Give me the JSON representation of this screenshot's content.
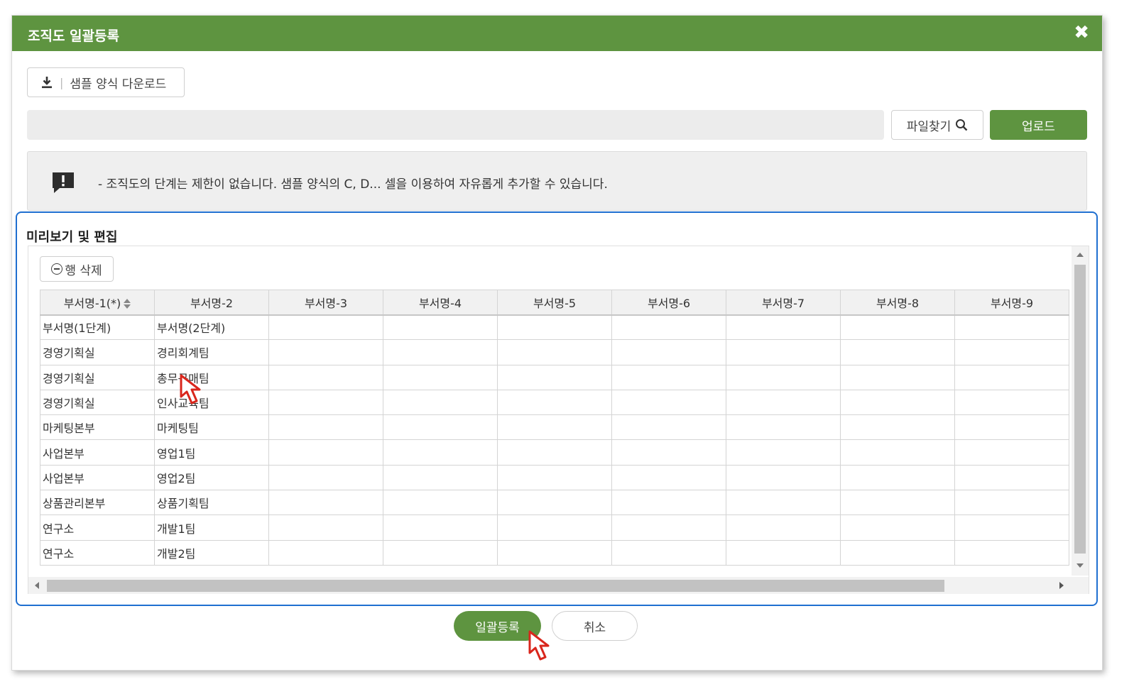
{
  "dialog": {
    "title": "조직도 일괄등록",
    "close_symbol": "✖"
  },
  "toolbar": {
    "download_label": "샘플 양식 다운로드",
    "download_separator": "|",
    "find_file_label": "파일찾기",
    "upload_label": "업로드"
  },
  "notice": {
    "text": "- 조직도의 단계는 제한이 없습니다. 샘플 양식의 C, D... 셀을 이용하여 자유롭게 추가할 수 있습니다."
  },
  "preview": {
    "title": "미리보기 및 편집",
    "delete_row_label": "행 삭제",
    "columns": [
      "부서명-1(*)",
      "부서명-2",
      "부서명-3",
      "부서명-4",
      "부서명-5",
      "부서명-6",
      "부서명-7",
      "부서명-8",
      "부서명-9"
    ],
    "rows": [
      [
        "부서명(1단계)",
        "부서명(2단계)"
      ],
      [
        "경영기획실",
        "경리회계팀"
      ],
      [
        "경영기획실",
        "총무구매팀"
      ],
      [
        "경영기획실",
        "인사교육팀"
      ],
      [
        "마케팅본부",
        "마케팅팀"
      ],
      [
        "사업본부",
        "영업1팀"
      ],
      [
        "사업본부",
        "영업2팀"
      ],
      [
        "상품관리본부",
        "상품기획팀"
      ],
      [
        "연구소",
        "개발1팀"
      ],
      [
        "연구소",
        "개발2팀"
      ]
    ]
  },
  "footer": {
    "register_label": "일괄등록",
    "cancel_label": "취소"
  },
  "colors": {
    "brand_green": "#5e9440",
    "highlight_blue": "#1f6fd0",
    "cursor_red": "#d9261c"
  },
  "icons": [
    "download-icon",
    "search-icon",
    "alert-icon",
    "minus-circle-icon",
    "sort-icon",
    "close-icon",
    "cursor-icon"
  ]
}
